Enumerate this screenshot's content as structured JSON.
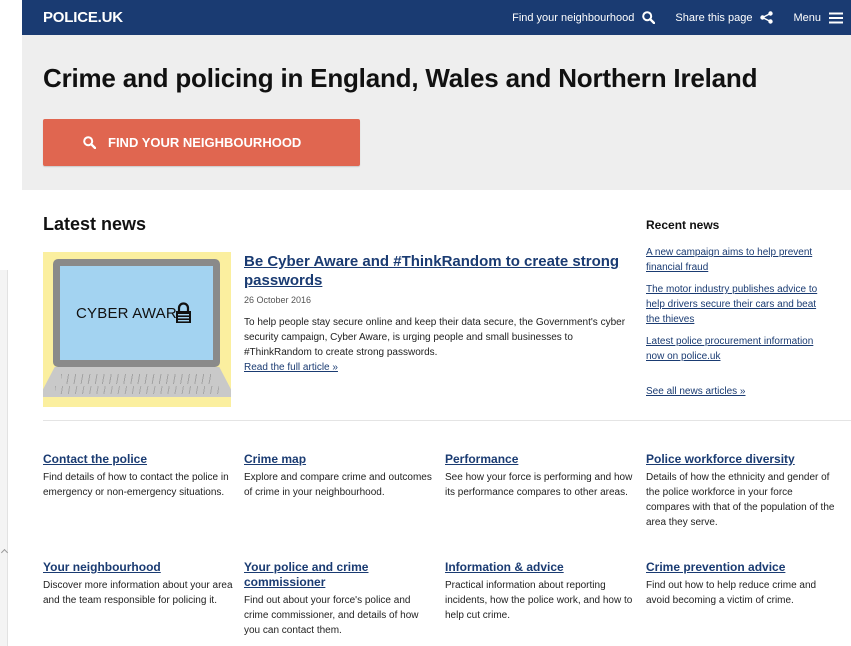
{
  "header": {
    "logo": "POLICE.UK",
    "nav": {
      "find": "Find your neighbourhood",
      "share": "Share this page",
      "menu": "Menu"
    }
  },
  "hero": {
    "title": "Crime and policing in England, Wales and Northern Ireland",
    "button": "FIND YOUR NEIGHBOURHOOD"
  },
  "colors": {
    "brand": "#1a3b72",
    "cta": "#e06650",
    "hero_bg": "#eeeeee"
  },
  "news": {
    "heading": "Latest news",
    "image_text": "CYBER AWAR",
    "article": {
      "title": "Be Cyber Aware and #ThinkRandom to create strong passwords",
      "date": "26 October 2016",
      "body": "To help people stay secure online and keep their data secure, the Government's cyber security campaign, Cyber Aware, is urging people and small businesses to #ThinkRandom to create strong passwords.",
      "link": "Read the full article »"
    },
    "recent": {
      "heading": "Recent news",
      "items": [
        "A new campaign aims to help prevent financial fraud",
        "The motor industry publishes advice to help drivers secure their cars and beat the thieves",
        "Latest police procurement information now on police.uk"
      ],
      "see_all": "See all news articles »"
    }
  },
  "tiles": [
    {
      "title": "Contact the police",
      "desc": "Find details of how to contact the police in emergency or non-emergency situations."
    },
    {
      "title": "Crime map",
      "desc": "Explore and compare crime and outcomes of crime in your neighbourhood."
    },
    {
      "title": "Performance",
      "desc": "See how your force is performing and how its performance compares to other areas."
    },
    {
      "title": "Police workforce diversity",
      "desc": "Details of how the ethnicity and gender of the police workforce in your force compares with that of the population of the area they serve."
    },
    {
      "title": "Your neighbourhood",
      "desc": "Discover more information about your area and the team responsible for policing it."
    },
    {
      "title": "Your police and crime commissioner",
      "desc": "Find out about your force's police and crime commissioner, and details of how you can contact them."
    },
    {
      "title": "Information & advice",
      "desc": "Practical information about reporting incidents, how the police work, and how to help cut crime."
    },
    {
      "title": "Crime prevention advice",
      "desc": "Find out how to help reduce crime and avoid becoming a victim of crime."
    }
  ]
}
